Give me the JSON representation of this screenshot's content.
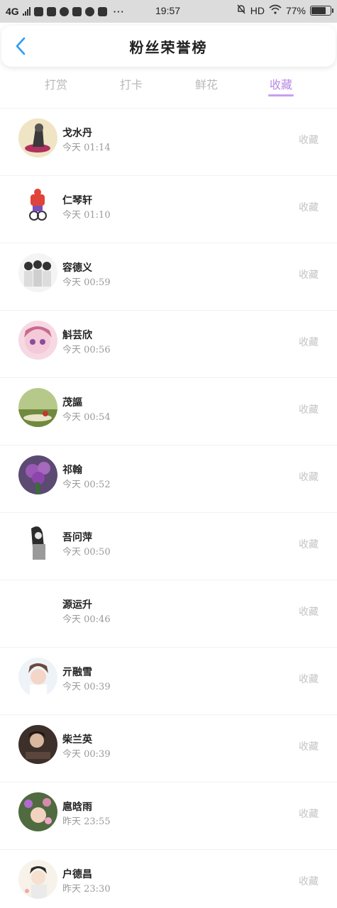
{
  "status_bar": {
    "network": "4G",
    "more": "···",
    "time": "19:57",
    "hd": "HD",
    "battery": "77%",
    "battery_level": 0.77
  },
  "header": {
    "title": "粉丝荣誉榜"
  },
  "tabs": [
    {
      "label": "打赏"
    },
    {
      "label": "打卡"
    },
    {
      "label": "鲜花"
    },
    {
      "label": "收藏"
    }
  ],
  "active_tab": "收藏",
  "colors": {
    "accent": "#b989e6",
    "back": "#2a9df4"
  },
  "list": [
    {
      "name": "戈水丹",
      "time": "今天 01:14",
      "action": "收藏"
    },
    {
      "name": "仁琴轩",
      "time": "今天 01:10",
      "action": "收藏"
    },
    {
      "name": "容德义",
      "time": "今天 00:59",
      "action": "收藏"
    },
    {
      "name": "斛芸欣",
      "time": "今天 00:56",
      "action": "收藏"
    },
    {
      "name": "茂謳",
      "time": "今天 00:54",
      "action": "收藏"
    },
    {
      "name": "祁翰",
      "time": "今天 00:52",
      "action": "收藏"
    },
    {
      "name": "吾问萍",
      "time": "今天 00:50",
      "action": "收藏"
    },
    {
      "name": "源运升",
      "time": "今天 00:46",
      "action": "收藏"
    },
    {
      "name": "亓融雪",
      "time": "今天 00:39",
      "action": "收藏"
    },
    {
      "name": "柴兰英",
      "time": "今天 00:39",
      "action": "收藏"
    },
    {
      "name": "扈晗雨",
      "time": "昨天 23:55",
      "action": "收藏"
    },
    {
      "name": "户德昌",
      "time": "昨天 23:30",
      "action": "收藏"
    }
  ]
}
